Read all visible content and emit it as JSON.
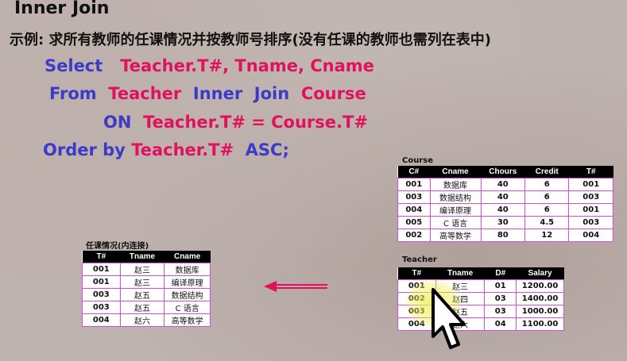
{
  "title": "Inner Join",
  "example": "示例: 求所有教师的任课情况并按教师号排序(没有任课的教师也需列在表中)",
  "sql": {
    "select_kw": "Select",
    "select_cols": "Teacher.T#, Tname, Cname",
    "from_kw": "From",
    "from_t1": "Teacher",
    "join_kw": "Inner  Join",
    "from_t2": "Course",
    "on_kw": "ON",
    "on_cond": "Teacher.T# = Course.T#",
    "order_kw": "Order by",
    "order_col": "Teacher.T#",
    "asc_kw": "ASC;"
  },
  "course": {
    "label": "Course",
    "headers": [
      "C#",
      "Cname",
      "Chours",
      "Credit",
      "T#"
    ],
    "rows": [
      [
        "001",
        "数据库",
        "40",
        "6",
        "001"
      ],
      [
        "003",
        "数据结构",
        "40",
        "6",
        "003"
      ],
      [
        "004",
        "编译原理",
        "40",
        "6",
        "001"
      ],
      [
        "005",
        "C 语言",
        "30",
        "4.5",
        "003"
      ],
      [
        "002",
        "高等数学",
        "80",
        "12",
        "004"
      ]
    ]
  },
  "teacher": {
    "label": "Teacher",
    "headers": [
      "T#",
      "Tname",
      "D#",
      "Salary"
    ],
    "rows": [
      [
        "001",
        "赵三",
        "01",
        "1200.00"
      ],
      [
        "002",
        "赵四",
        "03",
        "1400.00"
      ],
      [
        "003",
        "赵五",
        "03",
        "1000.00"
      ],
      [
        "004",
        "赵六",
        "04",
        "1100.00"
      ]
    ]
  },
  "result": {
    "label": "任课情况(内连接)",
    "headers": [
      "T#",
      "Tname",
      "Cname"
    ],
    "rows": [
      [
        "001",
        "赵三",
        "数据库"
      ],
      [
        "001",
        "赵三",
        "编译原理"
      ],
      [
        "003",
        "赵五",
        "数据结构"
      ],
      [
        "003",
        "赵五",
        "C 语言"
      ],
      [
        "004",
        "赵六",
        "高等数学"
      ]
    ]
  },
  "colors": {
    "keyword": "#3b3bc8",
    "identifier": "#e0115f",
    "arrow": "#e0115f",
    "cell_border": "#d24fd6"
  },
  "icons": {
    "arrow": "left-arrow-icon",
    "cursor": "mouse-cursor-icon"
  }
}
